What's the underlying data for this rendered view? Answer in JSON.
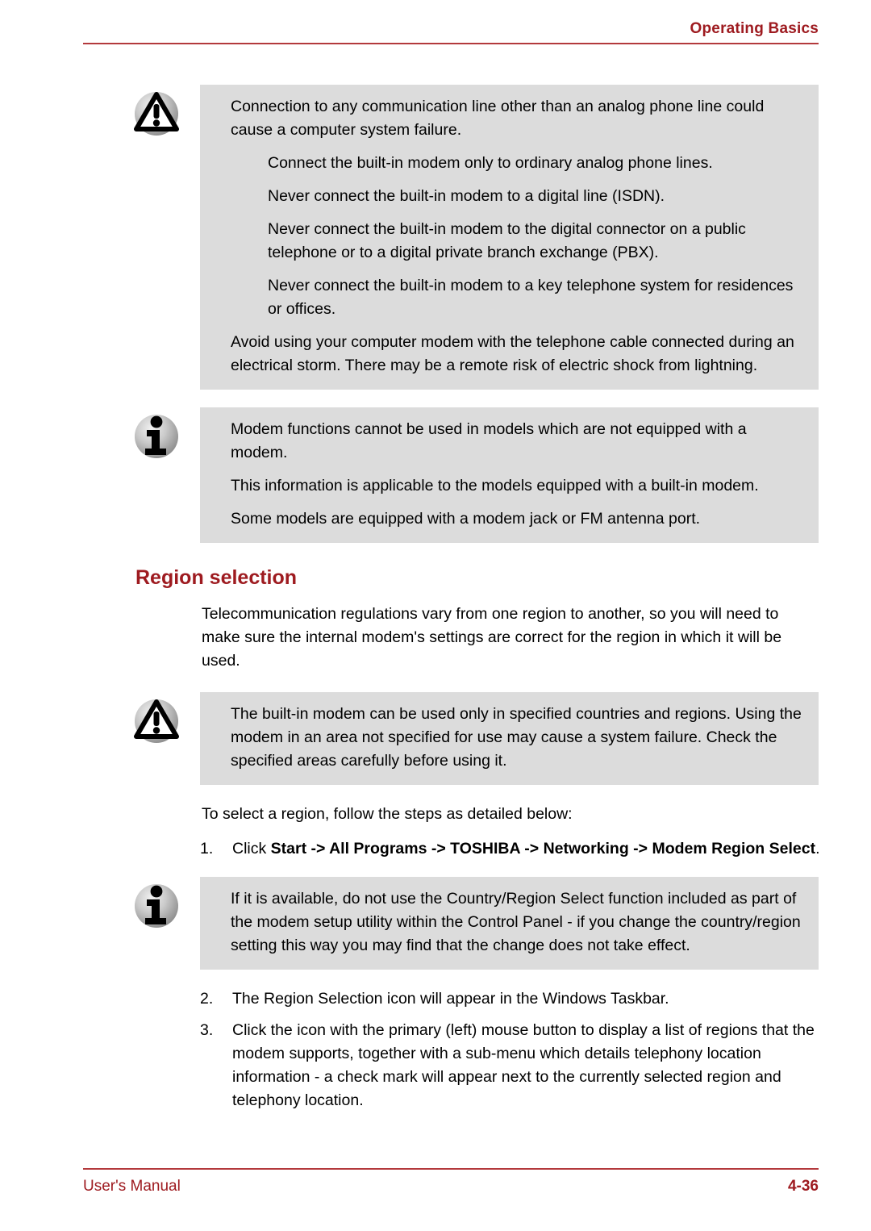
{
  "header": {
    "title": "Operating Basics",
    "accent_color": "#9E1B20",
    "rule_color": "#B3393C"
  },
  "footer": {
    "left_label": "User's Manual",
    "page_number": "4-36",
    "accent_color": "#9E1B20",
    "rule_color": "#B3393C"
  },
  "notes": {
    "caution_box_1": {
      "icon": "warning-triangle-icon",
      "background": "#DCDCDC",
      "paragraphs": [
        {
          "indent": false,
          "text": "Connection to any communication line other than an analog phone line could cause a computer system failure."
        },
        {
          "indent": true,
          "text": "Connect the built-in modem only to ordinary analog phone lines."
        },
        {
          "indent": true,
          "text": "Never connect the built-in modem to a digital line (ISDN)."
        },
        {
          "indent": true,
          "text": "Never connect the built-in modem to the digital connector on a public telephone or to a digital private branch exchange (PBX)."
        },
        {
          "indent": true,
          "text": "Never connect the built-in modem to a key telephone system for residences or offices."
        },
        {
          "indent": false,
          "text": "Avoid using your computer modem with the telephone cable connected during an electrical storm. There may be a remote risk of electric shock from lightning."
        }
      ]
    },
    "info_box_1": {
      "icon": "info-i-icon",
      "background": "#DCDCDC",
      "paragraphs": [
        {
          "indent": false,
          "text": "Modem functions cannot be used in models which are not equipped with a modem."
        },
        {
          "indent": false,
          "text": "This information is applicable to the models equipped with a built-in modem."
        },
        {
          "indent": false,
          "text": "Some models are equipped with a modem jack or FM antenna port."
        }
      ]
    },
    "caution_box_2": {
      "icon": "warning-triangle-icon",
      "background": "#DCDCDC",
      "paragraphs": [
        {
          "indent": false,
          "text": "The built-in modem can be used only in specified countries and regions. Using the modem in an area not specified for use may cause a system failure. Check the specified areas carefully before using it."
        }
      ]
    },
    "info_box_2": {
      "icon": "info-i-icon",
      "background": "#DCDCDC",
      "paragraphs": [
        {
          "indent": false,
          "text": "If it is available, do not use the Country/Region Select function included as part of the modem setup utility within the Control Panel - if you change the country/region setting this way you may find that the change does not take effect."
        }
      ]
    }
  },
  "section": {
    "heading": "Region selection",
    "intro_paragraph": "Telecommunication regulations vary from one region to another, so you will need to make sure the internal modem's settings are correct for the region in which it will be used.",
    "steps_lead_in": "To select a region, follow the steps as detailed below:",
    "steps": [
      {
        "number": "1.",
        "prefix": "Click ",
        "bold": "Start -> All Programs -> TOSHIBA -> Networking -> Modem Region Select",
        "suffix": "."
      },
      {
        "number": "2.",
        "prefix": "The Region Selection icon will appear in the Windows Taskbar.",
        "bold": "",
        "suffix": ""
      },
      {
        "number": "3.",
        "prefix": "Click the icon with the primary (left) mouse button to display a list of regions that the modem supports, together with a sub-menu which details telephony location information - a check mark will appear next to the currently selected region and telephony location.",
        "bold": "",
        "suffix": ""
      }
    ]
  }
}
